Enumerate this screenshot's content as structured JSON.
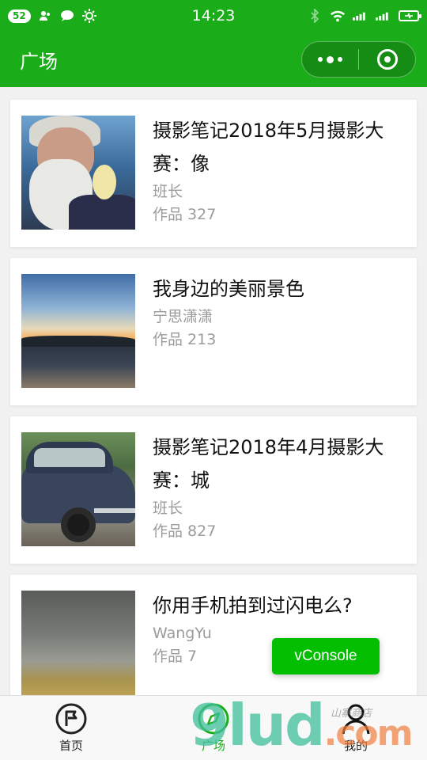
{
  "status_bar": {
    "notification_count": "52",
    "time": "14:23",
    "left_icons": [
      "contacts-icon",
      "chat-bubble-icon",
      "brightness-icon"
    ],
    "right_icons": [
      "bluetooth-icon",
      "wifi-icon",
      "signal-icon",
      "signal-icon",
      "battery-icon"
    ]
  },
  "nav": {
    "title": "广场",
    "capsule_icons": [
      "more-dots-icon",
      "close-circle-icon"
    ]
  },
  "posts": [
    {
      "title": "摄影笔记2018年5月摄影大赛：像",
      "author": "班长",
      "count": "作品 327"
    },
    {
      "title": "我身边的美丽景色",
      "author": "宁思潇潇",
      "count": "作品 213"
    },
    {
      "title": "摄影笔记2018年4月摄影大赛：城",
      "author": "班长",
      "count": "作品 827"
    },
    {
      "title": "你用手机拍到过闪电么?",
      "author": "WangYu",
      "count": "作品 7"
    }
  ],
  "vconsole": {
    "label": "vConsole"
  },
  "tabs": [
    {
      "label": "首页",
      "icon": "home-flag-icon",
      "active": false
    },
    {
      "label": "广场",
      "icon": "square-compass-icon",
      "active": true
    },
    {
      "label": "我的",
      "icon": "person-icon",
      "active": false
    }
  ],
  "watermark": {
    "brand": "9lud",
    "suffix": ".com",
    "small": "山寨商店"
  },
  "colors": {
    "accent": "#1aad19",
    "vconsole": "#04be02",
    "muted_text": "#9b9b9b"
  }
}
